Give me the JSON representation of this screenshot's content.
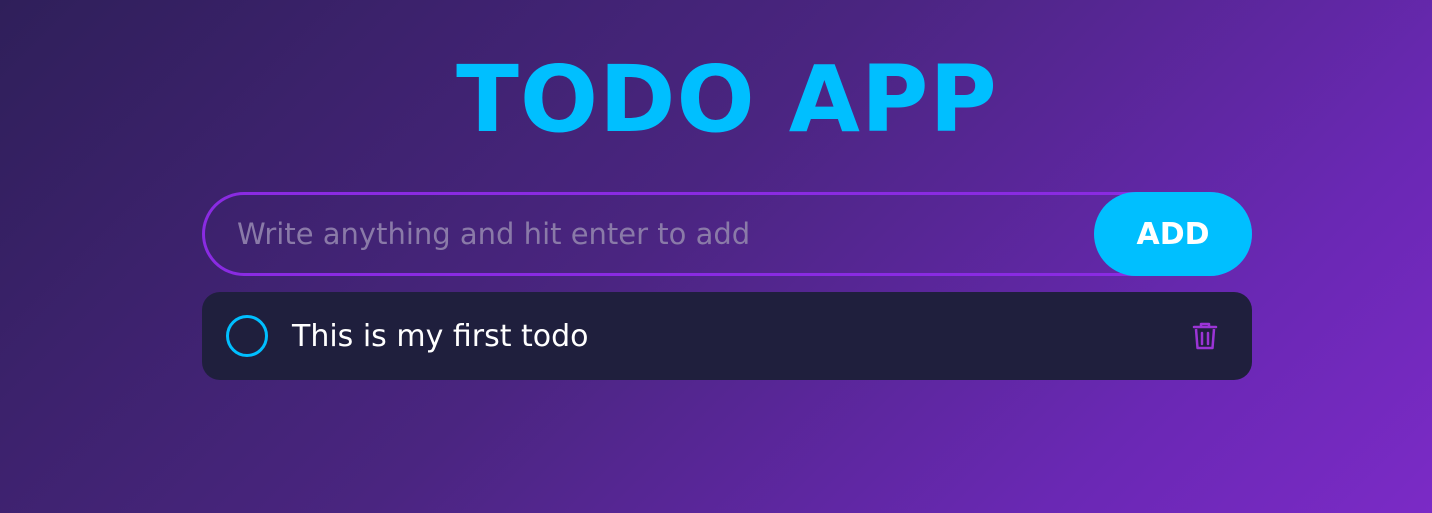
{
  "app": {
    "title": "TODO APP"
  },
  "form": {
    "placeholder": "Write anything and hit enter to add",
    "value": "",
    "add_label": "ADD"
  },
  "todos": [
    {
      "text": "This is my first todo",
      "completed": false
    }
  ],
  "icons": {
    "check": "circle-outline-icon",
    "delete": "trash-icon"
  },
  "colors": {
    "accent": "#00bfff",
    "border": "#8a2be2",
    "card": "#1f1f3d",
    "delete_icon": "#9b34d6"
  }
}
